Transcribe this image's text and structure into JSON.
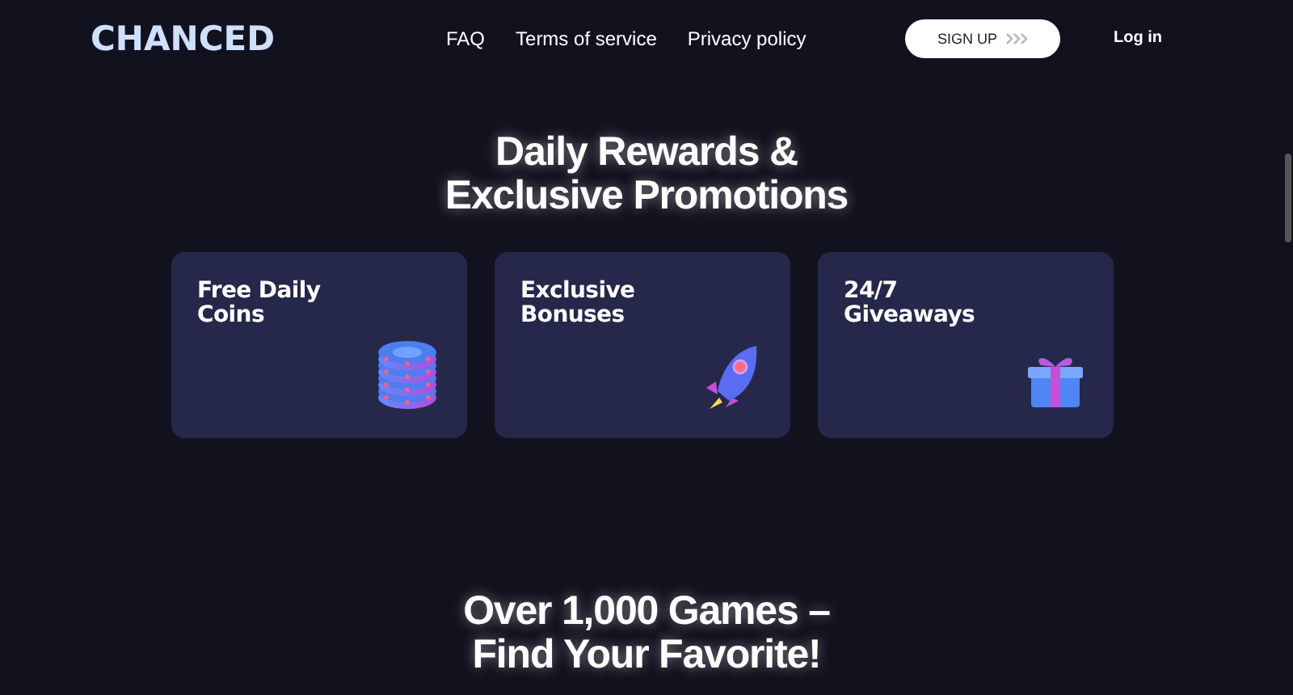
{
  "header": {
    "logo": "CHANCED",
    "links": [
      "FAQ",
      "Terms of service",
      "Privacy policy"
    ],
    "signup": "SIGN UP",
    "login": "Log in"
  },
  "promotions": {
    "heading_lines": [
      "Daily Rewards &",
      "Exclusive Promotions"
    ],
    "cards": [
      {
        "title_lines": [
          "Free Daily",
          "Coins"
        ],
        "kind": "coins"
      },
      {
        "title_lines": [
          "Exclusive",
          "Bonuses"
        ],
        "kind": "rocket"
      },
      {
        "title_lines": [
          "24/7",
          "Giveaways"
        ],
        "kind": "gift"
      }
    ]
  },
  "games": {
    "heading_lines": [
      "Over 1,000 Games –",
      "Find Your Favorite!"
    ]
  }
}
